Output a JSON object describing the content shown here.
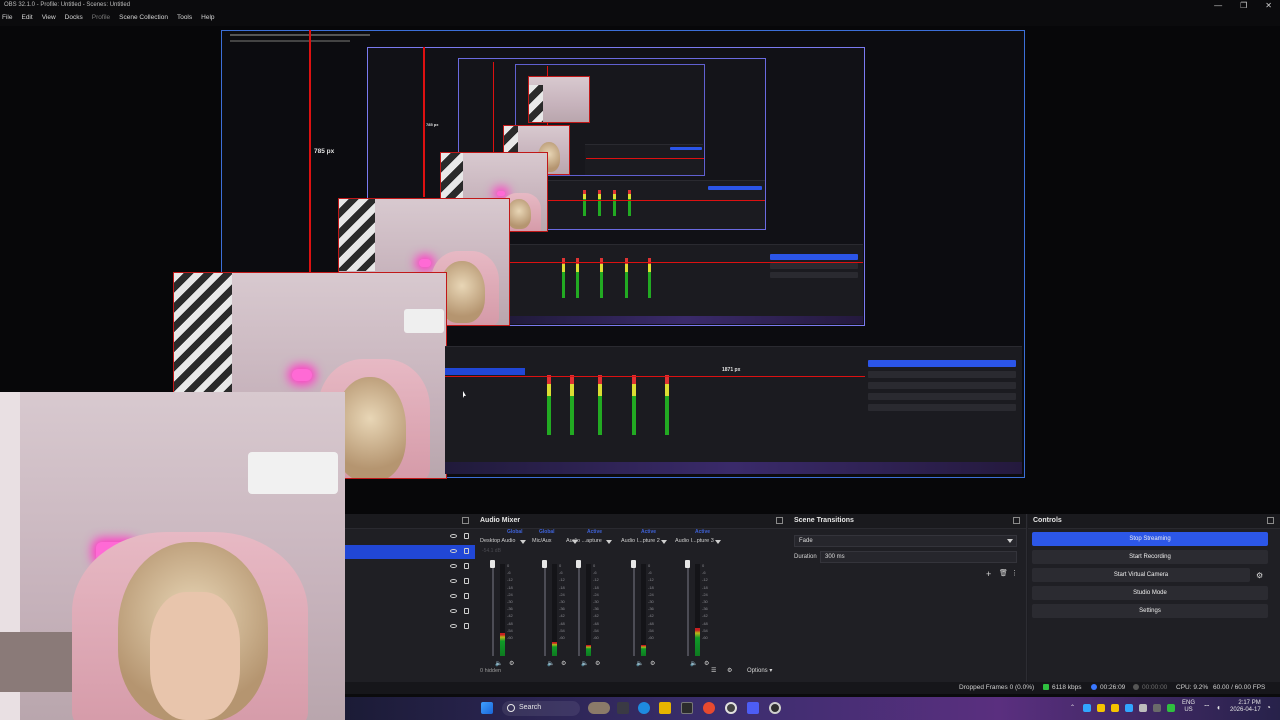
{
  "window": {
    "title": "OBS 32.1.0 - Profile: Untitled - Scenes: Untitled",
    "controls": [
      "—",
      "❐",
      "✕"
    ]
  },
  "menu": [
    "File",
    "Edit",
    "View",
    "Docks",
    "Profile",
    "Scene Collection",
    "Tools",
    "Help"
  ],
  "preview": {
    "labels": {
      "height_outer": "785 px",
      "height_inner": "785 px",
      "width_mini": "1871 px"
    },
    "mini_controls": {
      "buttons": [
        "Stop Streaming",
        "Start Recording",
        "Start Virtual Camera",
        "Studio Mode",
        "Settings"
      ],
      "docks": [
        "Audio Mixer",
        "Scene Transitions",
        "Controls"
      ],
      "status": "Dropped Frames 0 (0.0%)"
    }
  },
  "sources_dock": {
    "rows": 7,
    "selected_index": 1
  },
  "audio_mixer": {
    "title": "Audio Mixer",
    "tabs": [
      "Global",
      "Global",
      "Active",
      "Active",
      "Active"
    ],
    "channels": [
      {
        "name": "Desktop Audio",
        "db": "-54.1 dB",
        "level": 0.25
      },
      {
        "name": "Mic/Aux",
        "db": "",
        "level": 0.15
      },
      {
        "name": "Audio ...apture",
        "db": "",
        "level": 0.12
      },
      {
        "name": "Audio I...pture 2",
        "db": "",
        "level": 0.12
      },
      {
        "name": "Audio I...pture 3",
        "db": "",
        "level": 0.3
      }
    ],
    "scale": [
      "0",
      "-6",
      "-12",
      "-18",
      "-24",
      "-30",
      "-36",
      "-42",
      "-48",
      "-54",
      "-60"
    ],
    "hidden_text": "0 hidden",
    "options_label": "Options"
  },
  "scene_transitions": {
    "title": "Scene Transitions",
    "transition": "Fade",
    "duration_label": "Duration",
    "duration_value": "300 ms"
  },
  "controls": {
    "title": "Controls",
    "buttons": [
      "Stop Streaming",
      "Start Recording",
      "Start Virtual Camera",
      "Studio Mode",
      "Settings"
    ]
  },
  "status": {
    "dropped_frames": "Dropped Frames 0 (0.0%)",
    "bitrate": "6118 kbps",
    "stream_time": "00:26:09",
    "record_time": "00:00:00",
    "cpu": "CPU: 9.2%",
    "fps": "60.00 / 60.00 FPS"
  },
  "taskbar": {
    "search_text": "Search",
    "lang_top": "ENG",
    "lang_bottom": "US",
    "time": "2:17 PM",
    "date": "2026-04-17"
  },
  "colors": {
    "accent_blue": "#2c57e8",
    "selection_red": "#d11111",
    "meter_green": "#0f9a28"
  }
}
